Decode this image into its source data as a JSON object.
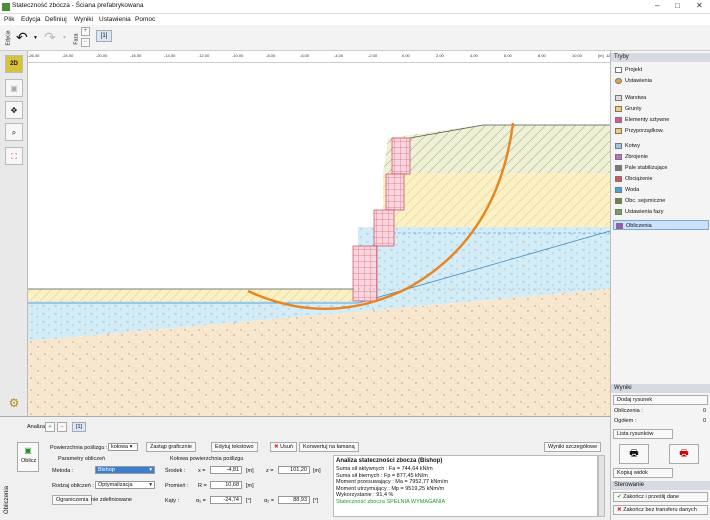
{
  "window": {
    "title": "Stateczność zbocza - Ściana prefabrykowana"
  },
  "menu": [
    "Plik",
    "Edycja",
    "Definiuj",
    "Wyniki",
    "Ustawienia",
    "Pomoc"
  ],
  "toolbar": {
    "edit_vertical": "Edycja",
    "stage_vertical": "Faza",
    "stage_number": "[1]",
    "mode_2d": "2D"
  },
  "ruler": {
    "ticks": [
      "-26,00",
      "-24,00",
      "-20,00",
      "-16,00",
      "-14,00",
      "-12,00",
      "-10,00",
      "-8,00",
      "-6,00",
      "-4,00",
      "-2,00",
      "0,00",
      "2,00",
      "4,00",
      "6,00",
      "8,00",
      "10,00",
      "12,00"
    ],
    "unit": "[m]"
  },
  "right_panel": {
    "header": "Tryby",
    "items": [
      "Projekt",
      "Ustawienia",
      "Warstwa",
      "Grunty",
      "Elementy sztywne",
      "Przyporządkow.",
      "Kotwy",
      "Zbrojenie",
      "Pale stabilizujące",
      "Obciążenie",
      "Woda",
      "Obc. sejsmiczne",
      "Ustawienia fazy",
      "Obliczenia"
    ],
    "results_header": "Wyniki",
    "add_drawing": "Dodaj rysunek",
    "calc_label": "Obliczenia :",
    "calc_value": "0",
    "total_label": "Ogółem :",
    "total_value": "0",
    "drawing_list": "Lista rysunków",
    "copy_view": "Kopiuj widok",
    "control_header": "Sterowanie",
    "finish_transfer": "Zakończ i prześlij dane",
    "finish_no_transfer": "Zakończ bez transferu danych"
  },
  "bottom": {
    "analysis_label": "Analiza :",
    "analysis_number": "[1]",
    "side_label": "Obliczenia",
    "calc_button": "Oblicz",
    "surface_label": "Powierzchnia poślizgu :",
    "surface_value": "kołowa",
    "replace_graphic": "Zastąp graficznie",
    "edit_text": "Edytuj tekstowo",
    "delete": "Usuń",
    "convert": "Konwertuj na łamaną",
    "detailed_results": "Wyniki szczegółowe",
    "params_group": "Parametry obliczeń",
    "method_label": "Metoda :",
    "method_value": "Bishop",
    "calc_type_label": "Rodzaj obliczeń :",
    "calc_type_value": "Optymalizacja",
    "restrictions_button": "Ograniczenia",
    "restrictions_value": "nie zdefiniowane",
    "circle_group": "Kołowa powierzchnia poślizgu",
    "center_label": "Środek :",
    "x_label": "x =",
    "x_value": "-4,81",
    "z_label": "z =",
    "z_value": "101,20",
    "radius_label": "Promień :",
    "r_label": "R =",
    "r_value": "10,68",
    "angles_label": "Kąty :",
    "a1_label": "α₁ =",
    "a1_value": "-24,74",
    "a2_label": "α₂ =",
    "a2_value": "88,93",
    "unit_m": "[m]",
    "unit_deg": "[°]"
  },
  "results": {
    "title": "Analiza stateczności zbocza (Bishop)",
    "lines": [
      "Suma sił aktywnych :      Fa =    744,64 kN/m",
      "Suma sił biernych :        Fp =    877,45 kN/m",
      "Moment przesuwający :   Ma =  7952,77 kNm/m",
      "Moment utrzymujący :    Mp =  9519,25 kNm/m",
      "Wykorzystanie : 91,4 %"
    ],
    "verdict": "Stateczność zbocza SPEŁNIA WYMAGANIA"
  },
  "colors": {
    "accent": "#f0a030",
    "slip_circle": "#e8851e",
    "reinforce": "#e05a7a",
    "water": "#cfe9f5",
    "selection": "#cce0f7"
  }
}
